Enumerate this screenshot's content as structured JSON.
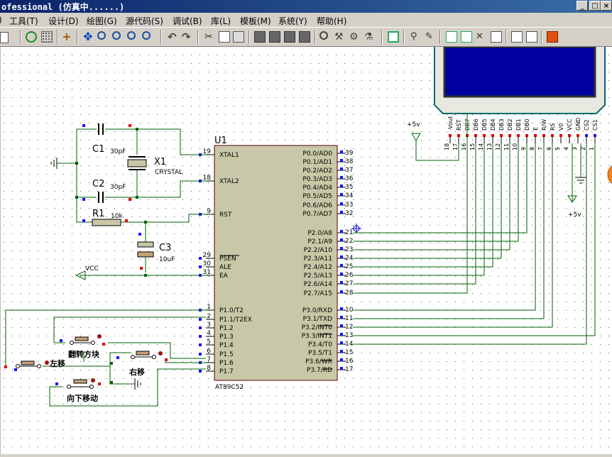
{
  "window": {
    "title": "ofessional (仿真中......)",
    "min": "_",
    "restore": "□",
    "close": "×"
  },
  "menu": [
    "工具(T)",
    "设计(D)",
    "绘图(G)",
    "源代码(S)",
    "调试(B)",
    "库(L)",
    "模板(M)",
    "系统(Y)",
    "帮助(H)"
  ],
  "schematic": {
    "u1_ref": "U1",
    "u1_part": "AT89C52",
    "left_pins": [
      {
        "num": "19",
        "label": "XTAL1"
      },
      {
        "num": "18",
        "label": "XTAL2"
      },
      {
        "num": "9",
        "label": "RST"
      },
      {
        "num": "29",
        "label": "PSEN"
      },
      {
        "num": "30",
        "label": "ALE"
      },
      {
        "num": "31",
        "label": "EA"
      },
      {
        "num": "1",
        "label": "P1.0/T2"
      },
      {
        "num": "2",
        "label": "P1.1/T2EX"
      },
      {
        "num": "3",
        "label": "P1.2"
      },
      {
        "num": "4",
        "label": "P1.3"
      },
      {
        "num": "5",
        "label": "P1.4"
      },
      {
        "num": "6",
        "label": "P1.5"
      },
      {
        "num": "7",
        "label": "P1.6"
      },
      {
        "num": "8",
        "label": "P1.7"
      }
    ],
    "right_pins": [
      {
        "num": "39",
        "label": "P0.0/AD0"
      },
      {
        "num": "38",
        "label": "P0.1/AD1"
      },
      {
        "num": "37",
        "label": "P0.2/AD2"
      },
      {
        "num": "36",
        "label": "P0.3/AD3"
      },
      {
        "num": "35",
        "label": "P0.4/AD4"
      },
      {
        "num": "34",
        "label": "P0.5/AD5"
      },
      {
        "num": "33",
        "label": "P0.6/AD6"
      },
      {
        "num": "32",
        "label": "P0.7/AD7"
      },
      {
        "num": "21",
        "label": "P2.0/A8"
      },
      {
        "num": "22",
        "label": "P2.1/A9"
      },
      {
        "num": "23",
        "label": "P2.2/A10"
      },
      {
        "num": "24",
        "label": "P2.3/A11"
      },
      {
        "num": "25",
        "label": "P2.4/A12"
      },
      {
        "num": "26",
        "label": "P2.5/A13"
      },
      {
        "num": "27",
        "label": "P2.6/A14"
      },
      {
        "num": "28",
        "label": "P2.7/A15"
      },
      {
        "num": "10",
        "label": "P3.0/RXD"
      },
      {
        "num": "11",
        "label": "P3.1/TXD"
      },
      {
        "num": "12",
        "label": "P3.2/INT0"
      },
      {
        "num": "13",
        "label": "P3.3/INT1"
      },
      {
        "num": "14",
        "label": "P3.4/T0"
      },
      {
        "num": "15",
        "label": "P3.5/T1"
      },
      {
        "num": "16",
        "label": "P3.6/WR"
      },
      {
        "num": "17",
        "label": "P3.7/RD"
      }
    ],
    "c1": {
      "ref": "C1",
      "value": "30pF"
    },
    "c2": {
      "ref": "C2",
      "value": "30pF"
    },
    "x1": {
      "ref": "X1",
      "value": "CRYSTAL"
    },
    "r1": {
      "ref": "R1",
      "value": "10k"
    },
    "c3": {
      "ref": "C3",
      "value": "10uF"
    },
    "vcc": "VCC",
    "plus5_left": "+5v",
    "plus5_right": "+5v",
    "btn_rotate": "翻转方块",
    "btn_left": "左移",
    "btn_right": "右移",
    "btn_down": "向下移动",
    "lcd_pins": [
      "-Vout",
      "RST",
      "DB7",
      "DB6",
      "DB5",
      "DB4",
      "DB3",
      "DB2",
      "DB1",
      "DB0",
      "E",
      "R/W",
      "RS",
      "V0",
      "VCC",
      "GND",
      "CS2",
      "CS1"
    ],
    "lcd_nums": [
      "18",
      "17",
      "16",
      "15",
      "14",
      "13",
      "12",
      "11",
      "10",
      "9",
      "8",
      "7",
      "6",
      "5",
      "4",
      "3",
      "2",
      "1"
    ]
  },
  "colors": {
    "wire": "#006000",
    "chip": "#c8c8a8",
    "pin_blue": "#1414ff",
    "pin_red": "#e00000",
    "lcd_frame": "#006b6b"
  }
}
